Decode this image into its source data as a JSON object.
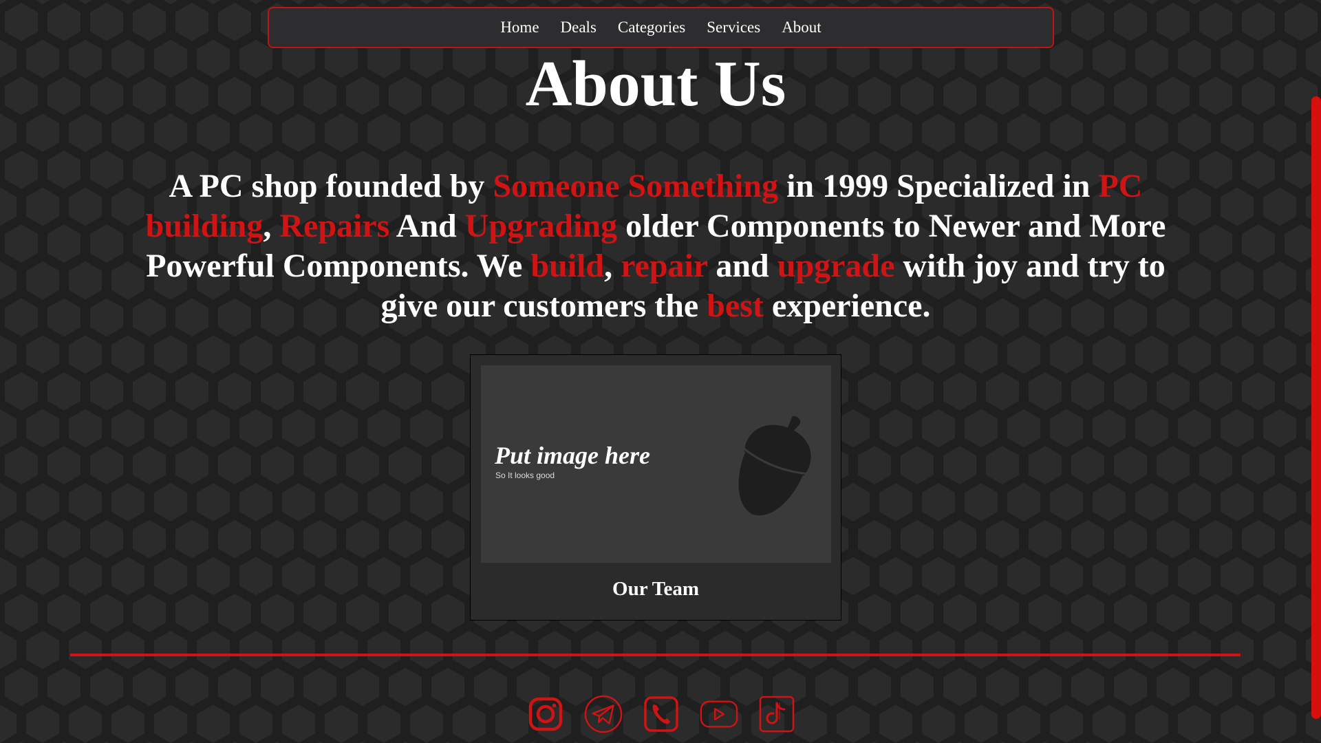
{
  "theme": {
    "accent": "#d01313",
    "background": "#1f1f20",
    "text": "#ffffff"
  },
  "nav": {
    "items": [
      "Home",
      "Deals",
      "Categories",
      "Services",
      "About"
    ]
  },
  "page": {
    "title": "About Us"
  },
  "about": {
    "segments": [
      {
        "text": "A PC shop founded by ",
        "highlight": false
      },
      {
        "text": "Someone Something",
        "highlight": true
      },
      {
        "text": " in 1999 Specialized in ",
        "highlight": false
      },
      {
        "text": "PC building",
        "highlight": true
      },
      {
        "text": ", ",
        "highlight": false
      },
      {
        "text": "Repairs",
        "highlight": true
      },
      {
        "text": " And ",
        "highlight": false
      },
      {
        "text": "Upgrading",
        "highlight": true
      },
      {
        "text": " older Components to Newer and More Powerful Components. We ",
        "highlight": false
      },
      {
        "text": "build",
        "highlight": true
      },
      {
        "text": ", ",
        "highlight": false
      },
      {
        "text": "repair",
        "highlight": true
      },
      {
        "text": " and ",
        "highlight": false
      },
      {
        "text": "upgrade",
        "highlight": true
      },
      {
        "text": " with joy and try to give our customers the ",
        "highlight": false
      },
      {
        "text": "best",
        "highlight": true
      },
      {
        "text": " experience.",
        "highlight": false
      }
    ]
  },
  "team_card": {
    "image_title": "Put image here",
    "image_subtitle": "So It looks good",
    "image_icon": "acorn-icon",
    "label": "Our Team"
  },
  "footer": {
    "socials": [
      {
        "icon": "instagram-icon"
      },
      {
        "icon": "telegram-icon"
      },
      {
        "icon": "phone-icon"
      },
      {
        "icon": "youtube-icon"
      },
      {
        "icon": "tiktok-icon"
      }
    ]
  }
}
